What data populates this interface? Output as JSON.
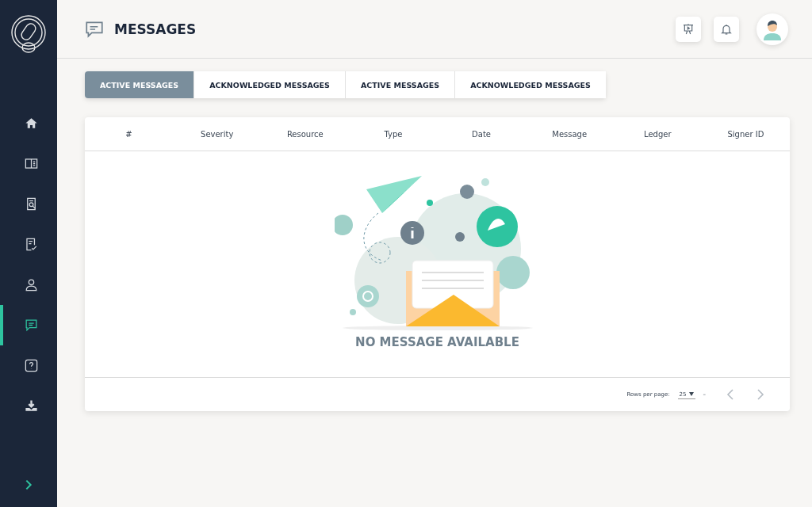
{
  "page_title": "MESSAGES",
  "sidebar": {
    "items": [
      {
        "kind": "home",
        "selected": false
      },
      {
        "kind": "book",
        "selected": false
      },
      {
        "kind": "search",
        "selected": false
      },
      {
        "kind": "check",
        "selected": false
      },
      {
        "kind": "user",
        "selected": false
      },
      {
        "kind": "message",
        "selected": true
      },
      {
        "kind": "help",
        "selected": false
      },
      {
        "kind": "download",
        "selected": false
      }
    ]
  },
  "tabs": [
    {
      "label": "ACTIVE MESSAGES",
      "selected": true
    },
    {
      "label": "ACKNOWLEDGED MESSAGES",
      "selected": false
    },
    {
      "label": "ACTIVE MESSAGES",
      "selected": false
    },
    {
      "label": "ACKNOWLEDGED MESSAGES",
      "selected": false
    }
  ],
  "table": {
    "columns": [
      "#",
      "Severity",
      "Resource",
      "Type",
      "Date",
      "Message",
      "Ledger",
      "Signer ID"
    ],
    "empty_text": "NO MESSAGE AVAILABLE"
  },
  "pagination": {
    "rows_per_page_label": "Rows per page:",
    "rows_per_page": "25",
    "range": "–"
  }
}
